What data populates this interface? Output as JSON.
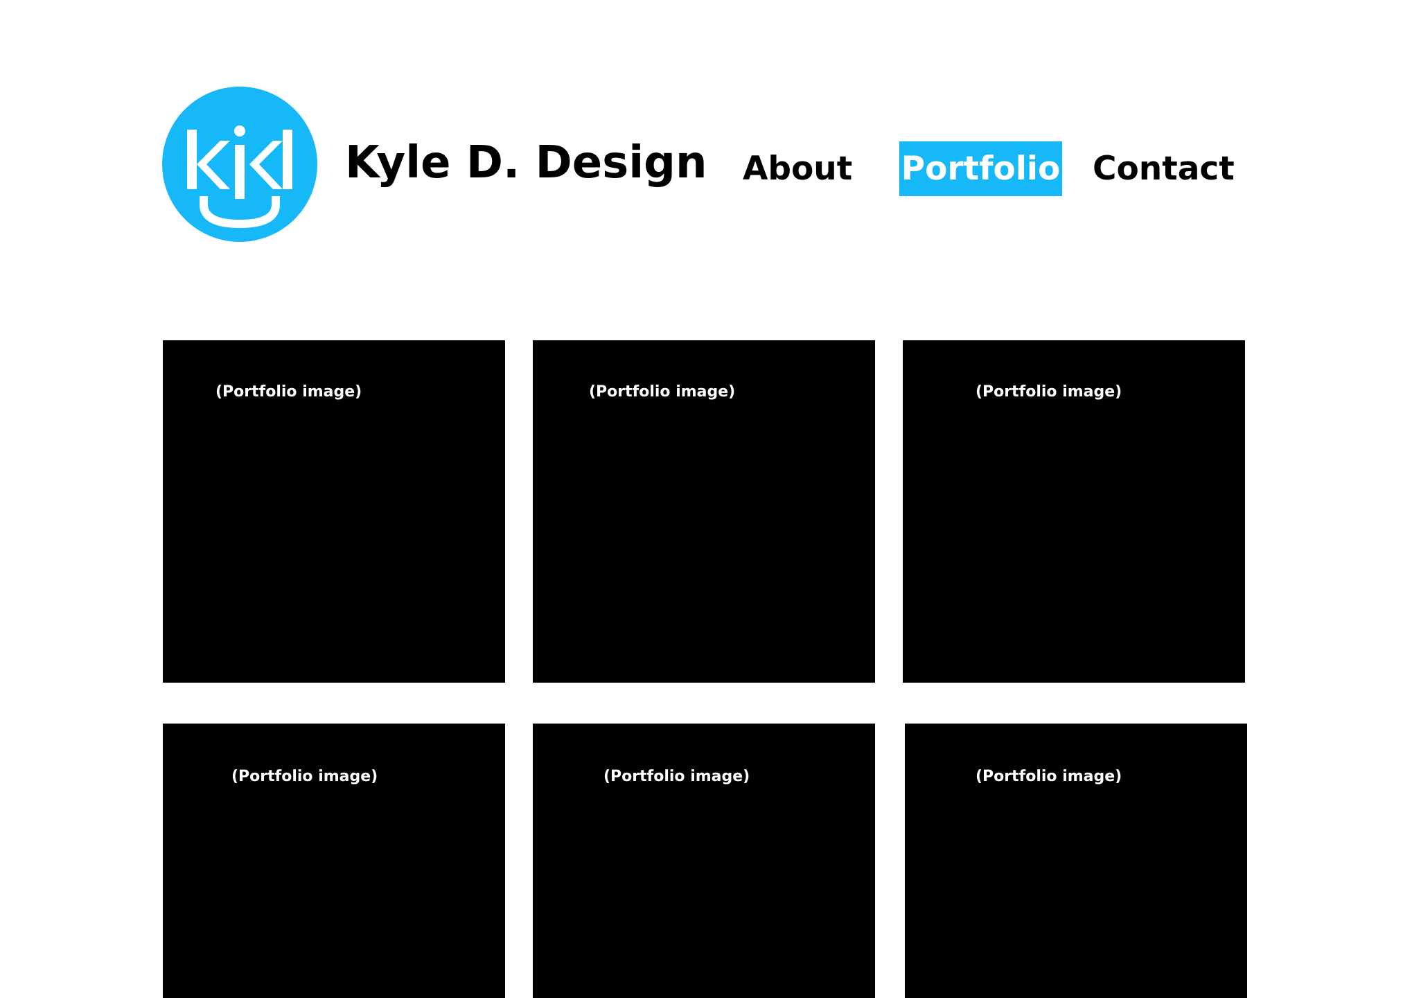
{
  "brand": {
    "logo_text": "kjd",
    "logo_color": "#16b8f8",
    "title": "Kyle D. Design"
  },
  "nav": {
    "items": [
      {
        "label": "About",
        "active": false
      },
      {
        "label": "Portfolio",
        "active": true
      },
      {
        "label": "Contact",
        "active": false
      }
    ],
    "active_color": "#16b8f8"
  },
  "portfolio": {
    "tiles": [
      {
        "label": "(Portfolio image)"
      },
      {
        "label": "(Portfolio image)"
      },
      {
        "label": "(Portfolio image)"
      },
      {
        "label": "(Portfolio image)"
      },
      {
        "label": "(Portfolio image)"
      },
      {
        "label": "(Portfolio image)"
      }
    ]
  }
}
